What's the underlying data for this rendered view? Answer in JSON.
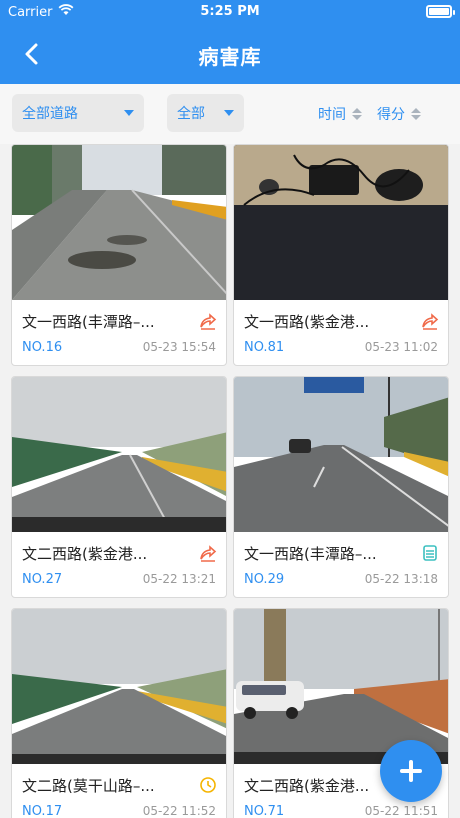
{
  "status_bar": {
    "carrier": "Carrier",
    "time": "5:25 PM"
  },
  "nav": {
    "title": "病害库",
    "back_icon": "chevron-left-icon"
  },
  "filters": {
    "road": "全部道路",
    "category": "全部",
    "sort_time": "时间",
    "sort_score": "得分"
  },
  "cards": [
    {
      "name": "文一西路(丰潭路–...",
      "no": "NO.16",
      "date": "05-23 15:54",
      "status_icon": "repair-arrow-icon",
      "status_color": "#f06a4a"
    },
    {
      "name": "文一西路(紫金港...",
      "no": "NO.81",
      "date": "05-23 11:02",
      "status_icon": "repair-arrow-icon",
      "status_color": "#f06a4a"
    },
    {
      "name": "文二西路(紫金港...",
      "no": "NO.27",
      "date": "05-22 13:21",
      "status_icon": "repair-arrow-icon",
      "status_color": "#f06a4a"
    },
    {
      "name": "文一西路(丰潭路–...",
      "no": "NO.29",
      "date": "05-22 13:18",
      "status_icon": "stack-icon",
      "status_color": "#3cc0c0"
    },
    {
      "name": "文二路(莫干山路–...",
      "no": "NO.17",
      "date": "05-22 11:52",
      "status_icon": "clock-icon",
      "status_color": "#f5b400"
    },
    {
      "name": "文二西路(紫金港...",
      "no": "NO.71",
      "date": "05-22 11:51",
      "status_icon": "add-icon",
      "status_color": "#2f8ff0"
    }
  ],
  "colors": {
    "primary": "#2f8ff0",
    "background": "#f2f2f2"
  }
}
